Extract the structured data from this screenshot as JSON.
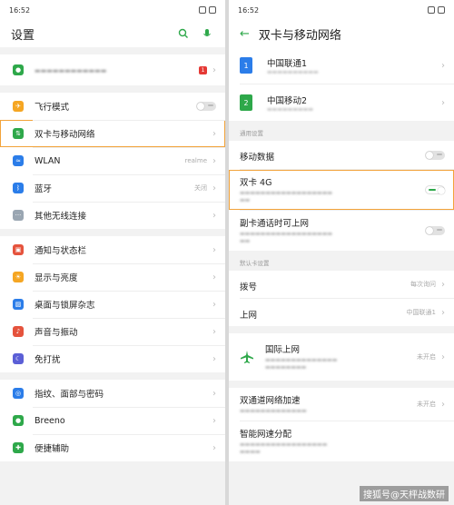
{
  "left": {
    "status": {
      "time": "16:52",
      "signal": "3ill 3ill HD",
      "wifi": "≈"
    },
    "title": "设置",
    "top_item": {
      "label": "",
      "badge": "1"
    },
    "network_group": [
      {
        "name": "airplane",
        "label": "飞行模式",
        "icon": "airplane-icon",
        "color": "#f5a623",
        "type": "toggle"
      },
      {
        "name": "dual-sim",
        "label": "双卡与移动网络",
        "icon": "dual-sim-icon",
        "color": "#2ea84a",
        "type": "chev",
        "highlight": true
      },
      {
        "name": "wlan",
        "label": "WLAN",
        "icon": "wifi-icon",
        "color": "#2b7de9",
        "value": "realme",
        "type": "chev"
      },
      {
        "name": "bluetooth",
        "label": "蓝牙",
        "icon": "bluetooth-icon",
        "color": "#2b7de9",
        "value": "关闭",
        "type": "chev"
      },
      {
        "name": "other-wireless",
        "label": "其他无线连接",
        "icon": "more-icon",
        "color": "#9aa6b2",
        "type": "chev"
      }
    ],
    "display_group": [
      {
        "name": "notification",
        "label": "通知与状态栏",
        "icon": "notification-icon",
        "color": "#e5533d",
        "type": "chev"
      },
      {
        "name": "display",
        "label": "显示与亮度",
        "icon": "brightness-icon",
        "color": "#f5a623",
        "type": "chev"
      },
      {
        "name": "wallpaper",
        "label": "桌面与锁屏杂志",
        "icon": "wallpaper-icon",
        "color": "#2b7de9",
        "type": "chev"
      },
      {
        "name": "sound",
        "label": "声音与振动",
        "icon": "sound-icon",
        "color": "#e5533d",
        "type": "chev"
      },
      {
        "name": "dnd",
        "label": "免打扰",
        "icon": "moon-icon",
        "color": "#5b5fd6",
        "type": "chev"
      }
    ],
    "security_group": [
      {
        "name": "fingerprint",
        "label": "指纹、面部与密码",
        "icon": "fingerprint-icon",
        "color": "#2b7de9",
        "type": "chev"
      },
      {
        "name": "breeno",
        "label": "Breeno",
        "icon": "breeno-icon",
        "color": "#2ea84a",
        "type": "chev"
      },
      {
        "name": "accessibility",
        "label": "便捷辅助",
        "icon": "accessibility-icon",
        "color": "#2ea84a",
        "type": "chev"
      }
    ]
  },
  "right": {
    "status": {
      "time": "16:52",
      "signal": "3ill 3ill HD"
    },
    "title": "双卡与移动网络",
    "sims": [
      {
        "name": "中国联通1",
        "color": "#2b7de9",
        "icon": "sim-card-icon"
      },
      {
        "name": "中国移动2",
        "color": "#2ea84a",
        "icon": "sim-card-icon"
      }
    ],
    "section_general": "通用设置",
    "mobile_data": "移动数据",
    "dual4g": {
      "title": "双卡 4G",
      "toggle": "on"
    },
    "sub_sim": {
      "title": "副卡通话时可上网",
      "toggle": "off"
    },
    "section_default": "默认卡设置",
    "call": {
      "title": "拨号",
      "value": "每次询问"
    },
    "internet": {
      "title": "上网",
      "value": "中国联通1"
    },
    "roaming": {
      "title": "国际上网",
      "value": "未开启"
    },
    "dual_channel": {
      "title": "双通道网络加速",
      "value": "未开启"
    },
    "smart_switch": {
      "title": "智能网速分配"
    },
    "watermark": "搜狐号@天枰战数研"
  },
  "colors": {
    "accent": "#2ea84a",
    "highlight": "#f2a33a"
  }
}
